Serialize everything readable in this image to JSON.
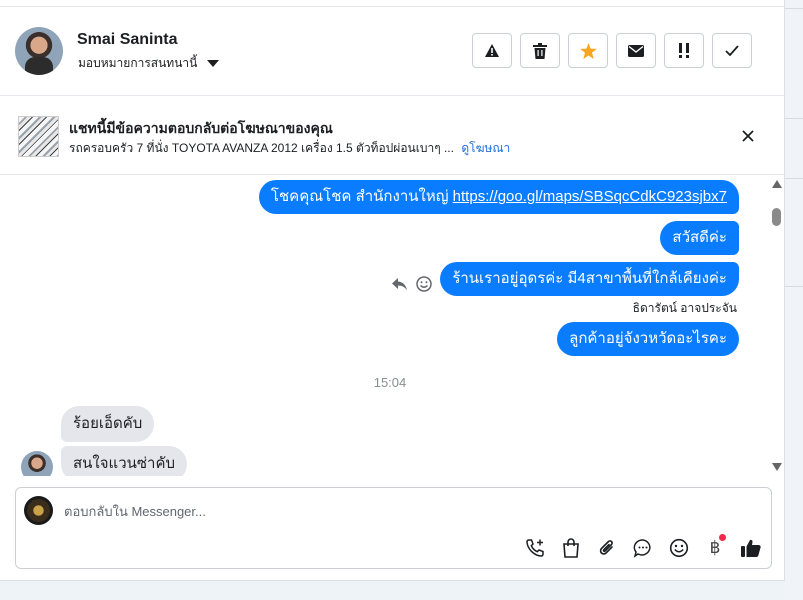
{
  "header": {
    "contact_name": "Smai Saninta",
    "assign_label": "มอบหมายการสนทนานี้"
  },
  "ad": {
    "title": "แชทนี้มีข้อความตอบกลับต่อโฆษณาของคุณ",
    "description": "รถครอบครัว 7 ที่นั่ง TOYOTA AVANZA 2012 เครื่อง 1.5 ตัวท็อปผ่อนเบาๆ ...",
    "link_label": "ดูโฆษณา"
  },
  "messages": {
    "out": [
      {
        "text": "โชคคุณโชค สำนักงานใหญ่ ",
        "link": "https://goo.gl/maps/SBSqcCdkC923sjbx7"
      },
      {
        "text": "สวัสดีค่ะ"
      },
      {
        "text": "ร้านเราอยู่อุดรค่ะ มี4สาขาพื้นที่ใกล้เคียงค่ะ"
      },
      {
        "text": "ลูกค้าอยู่จังวหวัดอะไรคะ"
      }
    ],
    "sender_name": "ธิดารัตน์ อาจประจัน",
    "timestamp": "15:04",
    "in": [
      {
        "text": "ร้อยเอ็ดคับ"
      },
      {
        "text": "สนใจแวนซ่าคับ"
      }
    ]
  },
  "composer": {
    "placeholder": "ตอบกลับใน Messenger..."
  },
  "colors": {
    "outgoing_bubble": "#0a7cff",
    "incoming_bubble": "#e4e6eb",
    "star": "#f5a623",
    "link": "#216fdb",
    "notification_dot": "#f02849"
  },
  "icons": {
    "header_actions": [
      "warning-icon",
      "trash-icon",
      "star-icon",
      "mail-icon",
      "priority-icon",
      "check-icon"
    ],
    "composer_tools": [
      "phone-add-icon",
      "shopping-bag-icon",
      "paperclip-icon",
      "chat-bubble-icon",
      "emoji-icon",
      "baht-icon",
      "thumbs-up-icon"
    ]
  }
}
